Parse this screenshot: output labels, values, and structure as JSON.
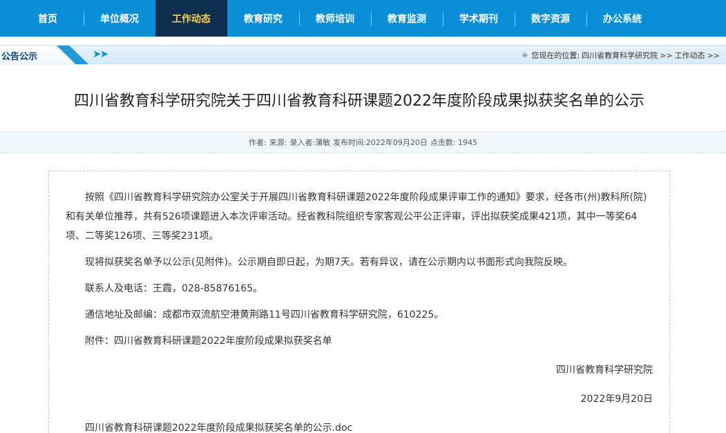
{
  "nav": {
    "items": [
      {
        "label": "首页",
        "active": false
      },
      {
        "label": "单位概况",
        "active": false
      },
      {
        "label": "工作动态",
        "active": true
      },
      {
        "label": "教育研究",
        "active": false
      },
      {
        "label": "教师培训",
        "active": false
      },
      {
        "label": "教育监测",
        "active": false
      },
      {
        "label": "学术期刊",
        "active": false
      },
      {
        "label": "数字资源",
        "active": false
      },
      {
        "label": "办公系统",
        "active": false
      }
    ]
  },
  "notice_bar": {
    "tab_label": "公告公示",
    "arrows": "➤➤",
    "breadcrumb": {
      "prefix": "您现在的位置:",
      "items": [
        "四川省教育科学研究院",
        ">>",
        "工作动态",
        ">>"
      ]
    }
  },
  "article": {
    "title": "四川省教育科学研究院关于四川省教育科研课题2022年度阶段成果拟获奖名单的公示",
    "meta": {
      "author": "作者:",
      "source": "来源:",
      "entered_by": "录入者:蒲敏",
      "published": "发布时间:2022年09月20日",
      "clicks": "点击数: 1945"
    },
    "paragraphs": [
      "按照《四川省教育科学研究院办公室关于开展四川省教育科研课题2022年度阶段成果评审工作的通知》要求，经各市(州)教科所(院)和有关单位推荐，共有526项课题进入本次评审活动。经省教科院组织专家客观公平公正评审，评出拟获奖成果421项，其中一等奖64项、二等奖126项、三等奖231项。",
      "现将拟获奖名单予以公示(见附件)。公示期自即日起，为期7天。若有异议，请在公示期内以书面形式向我院反映。",
      "联系人及电话：王霞，028-85876165。",
      "通信地址及邮编：成都市双流航空港黄荆路11号四川省教育科学研究院，610225。",
      "附件：四川省教育科研课题2022年度阶段成果拟获奖名单"
    ],
    "signature_org": "四川省教育科学研究院",
    "signature_date": "2022年9月20日",
    "attachment_link": "四川省教育科研课题2022年度阶段成果拟获奖名单的公示.doc"
  },
  "colors": {
    "nav_bg": "#0a8fd6",
    "nav_active_bg": "#0d2e4f",
    "nav_active_text": "#ffd24a"
  }
}
